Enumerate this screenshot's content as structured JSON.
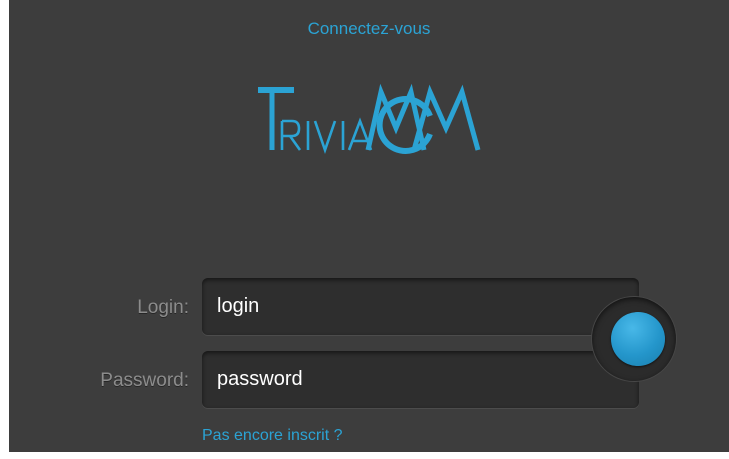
{
  "header": {
    "title": "Connectez-vous"
  },
  "logo": {
    "name": "TriviaMCM",
    "color": "#2ba3d4"
  },
  "form": {
    "login_label": "Login:",
    "login_value": "login",
    "password_label": "Password:",
    "password_value": "password",
    "submit_icon": "circle-button-icon"
  },
  "footer": {
    "signup_link": "Pas encore inscrit ?"
  },
  "colors": {
    "background": "#3d3d3d",
    "accent": "#2ba3d4",
    "field": "#2e2e2e",
    "label": "#8c8c8c"
  }
}
